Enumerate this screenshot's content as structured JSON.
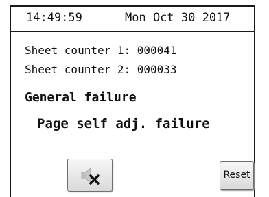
{
  "header": {
    "time": "14:49:59",
    "date": "Mon Oct 30 2017"
  },
  "counters": {
    "sheet_counter_1": "Sheet counter 1: 000041",
    "sheet_counter_2": "Sheet counter 2: 000033"
  },
  "errors": {
    "general": "General failure",
    "detail": "Page self adj. failure"
  },
  "buttons": {
    "mute_icon": "speaker-muted-icon",
    "reset_label": "Reset"
  }
}
